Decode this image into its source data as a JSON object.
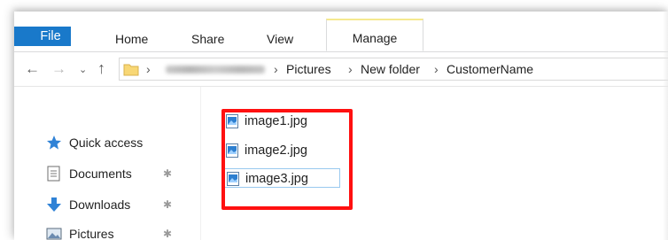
{
  "ribbon": {
    "tabs": {
      "file": "File",
      "home": "Home",
      "share": "Share",
      "view": "View",
      "manage": "Manage"
    },
    "accent": "#1979ca",
    "manage_accent": "#f5e98f"
  },
  "address": {
    "separator": "›",
    "crumbs": [
      "Pictures",
      "New folder",
      "CustomerName"
    ],
    "redacted_segment": true
  },
  "nav": {
    "back_icon": "arrow-left-icon",
    "forward_icon": "arrow-right-icon",
    "up_icon": "arrow-up-icon",
    "items": [
      {
        "label": "Quick access",
        "icon": "star-icon",
        "pinned": false
      },
      {
        "label": "Documents",
        "icon": "documents-icon",
        "pinned": true
      },
      {
        "label": "Downloads",
        "icon": "download-icon",
        "pinned": true
      },
      {
        "label": "Pictures",
        "icon": "pictures-icon",
        "pinned": true
      }
    ]
  },
  "files": [
    {
      "name": "image1.jpg",
      "selected": false
    },
    {
      "name": "image2.jpg",
      "selected": false
    },
    {
      "name": "image3.jpg",
      "selected": true
    }
  ],
  "annotation": {
    "color": "#ff1010"
  }
}
